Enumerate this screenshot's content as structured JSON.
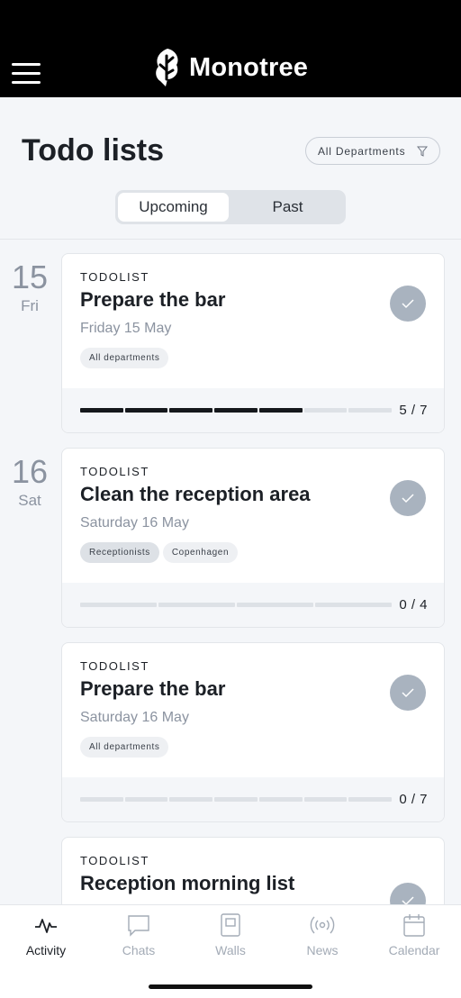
{
  "header": {
    "brand": "Monotree",
    "menu_icon": "hamburger-menu-icon",
    "logo_icon": "monotree-leaf-logo"
  },
  "page": {
    "title": "Todo lists",
    "filter_label": "All Departments",
    "filter_icon": "filter-funnel-icon"
  },
  "tabs_toggle": {
    "active": "Upcoming",
    "inactive": "Past"
  },
  "date_groups": [
    {
      "day_number": "15",
      "weekday": "Fri"
    },
    {
      "day_number": "16",
      "weekday": "Sat"
    }
  ],
  "cards": [
    {
      "type": "TODOLIST",
      "title": "Prepare the bar",
      "date": "Friday 15 May",
      "tags": [
        "All departments"
      ],
      "done": 5,
      "total": 7,
      "progress_text": "5 / 7"
    },
    {
      "type": "TODOLIST",
      "title": "Clean the reception area",
      "date": "Saturday 16 May",
      "tags": [
        "Receptionists",
        "Copenhagen"
      ],
      "done": 0,
      "total": 4,
      "progress_text": "0 / 4"
    },
    {
      "type": "TODOLIST",
      "title": "Prepare the bar",
      "date": "Saturday 16 May",
      "tags": [
        "All departments"
      ],
      "done": 0,
      "total": 7,
      "progress_text": "0 / 7"
    },
    {
      "type": "TODOLIST",
      "title": "Reception morning list"
    }
  ],
  "bottom_nav": [
    {
      "label": "Activity",
      "icon": "activity-pulse-icon",
      "active": true
    },
    {
      "label": "Chats",
      "icon": "chat-bubble-icon",
      "active": false
    },
    {
      "label": "Walls",
      "icon": "wall-board-icon",
      "active": false
    },
    {
      "label": "News",
      "icon": "broadcast-icon",
      "active": false
    },
    {
      "label": "Calendar",
      "icon": "calendar-icon",
      "active": false
    }
  ],
  "colors": {
    "header_bg": "#000000",
    "accent_dark": "#15181c",
    "muted": "#8b93a0",
    "check_bg": "#a9b3bf"
  }
}
